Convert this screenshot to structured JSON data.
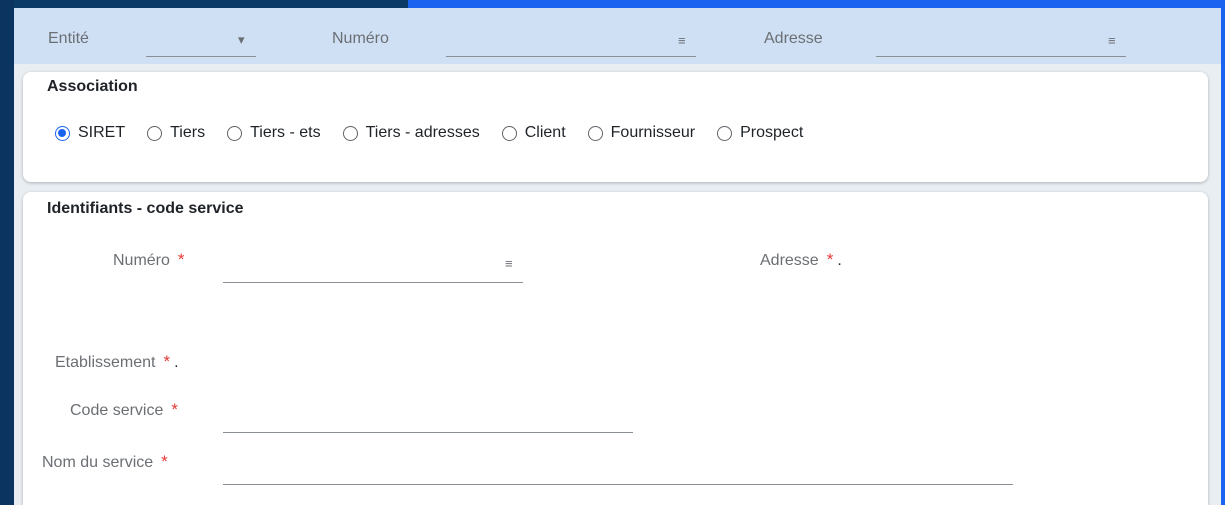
{
  "filter_bar": {
    "entity_label": "Entité",
    "entity_dropdown_icon": "▾",
    "number_label": "Numéro",
    "address_label": "Adresse",
    "list_icon": "≡"
  },
  "association": {
    "title": "Association",
    "options": [
      {
        "label": "SIRET",
        "selected": true
      },
      {
        "label": "Tiers",
        "selected": false
      },
      {
        "label": "Tiers - ets",
        "selected": false
      },
      {
        "label": "Tiers - adresses",
        "selected": false
      },
      {
        "label": "Client",
        "selected": false
      },
      {
        "label": "Fournisseur",
        "selected": false
      },
      {
        "label": "Prospect",
        "selected": false
      }
    ]
  },
  "identifiers": {
    "title": "Identifiants - code service",
    "number_label": "Numéro",
    "address_label": "Adresse",
    "establishment_label": "Etablissement",
    "service_code_label": "Code service",
    "service_name_label": "Nom du service",
    "required_mark": "*",
    "empty_value": ".",
    "list_icon": "≡"
  },
  "colors": {
    "accent": "#1a63f0",
    "required": "#e53935",
    "filter_bg": "#cfe0f4"
  }
}
